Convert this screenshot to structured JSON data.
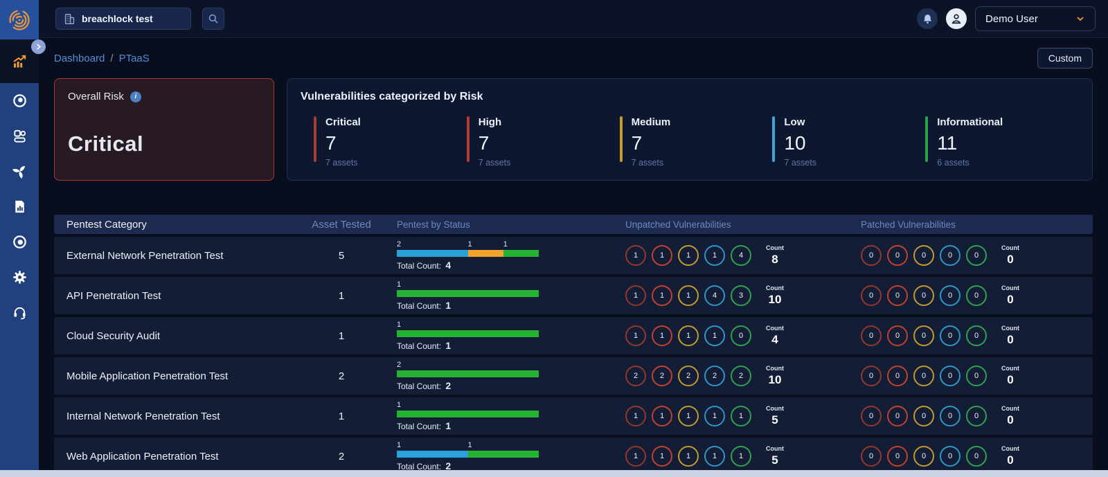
{
  "colors": {
    "accent_orange": "#f09b33",
    "severity_rings": [
      "#94372c",
      "#c2412f",
      "#c29b2f",
      "#2f96c8",
      "#30a24f"
    ],
    "risk_bars": {
      "critical": "#a93b32",
      "high": "#b73a2e",
      "medium": "#c79a2b",
      "low": "#3aa6d4",
      "informational": "#2aa24a"
    },
    "status_bar": {
      "blue": "#2aa4d8",
      "orange": "#f4a42c",
      "green": "#25b233"
    }
  },
  "topbar": {
    "search_value": "breachlock test",
    "user_label": "Demo User"
  },
  "sidebar": {
    "items": [
      {
        "icon": "trending-chart-icon",
        "active": true
      },
      {
        "icon": "monitor-eye-icon",
        "active": false
      },
      {
        "icon": "assets-icon",
        "active": false
      },
      {
        "icon": "scan-spiral-icon",
        "active": false
      },
      {
        "icon": "reports-icon",
        "active": false
      },
      {
        "icon": "target-icon",
        "active": false
      },
      {
        "icon": "settings-gear-icon",
        "active": false
      },
      {
        "icon": "support-headset-icon",
        "active": false
      }
    ]
  },
  "breadcrumb": {
    "section": "Dashboard",
    "separator": "/",
    "page": "PTaaS"
  },
  "actions": {
    "custom_label": "Custom"
  },
  "overall_risk": {
    "label": "Overall Risk",
    "value": "Critical"
  },
  "risk_summary": {
    "title": "Vulnerabilities categorized by Risk",
    "items": [
      {
        "label": "Critical",
        "value": "7",
        "assets": "7 assets",
        "color": "#a93b32"
      },
      {
        "label": "High",
        "value": "7",
        "assets": "7 assets",
        "color": "#b73a2e"
      },
      {
        "label": "Medium",
        "value": "7",
        "assets": "7 assets",
        "color": "#c79a2b"
      },
      {
        "label": "Low",
        "value": "10",
        "assets": "7 assets",
        "color": "#3aa6d4"
      },
      {
        "label": "Informational",
        "value": "11",
        "assets": "6 assets",
        "color": "#2aa24a"
      }
    ]
  },
  "table": {
    "columns": [
      "Pentest Category",
      "Asset Tested",
      "Pentest by Status",
      "Unpatched Vulnerabilities",
      "Patched Vulnerabilities"
    ],
    "total_count_label": "Total Count:",
    "count_label": "Count",
    "rows": [
      {
        "category": "External Network Penetration Test",
        "assets_tested": "5",
        "segments": [
          {
            "value": 2,
            "color": "#2aa4d8"
          },
          {
            "value": 1,
            "color": "#f4a42c"
          },
          {
            "value": 1,
            "color": "#25b233"
          }
        ],
        "total_count": "4",
        "unpatched": {
          "values": [
            "1",
            "1",
            "1",
            "1",
            "4"
          ],
          "count": "8"
        },
        "patched": {
          "values": [
            "0",
            "0",
            "0",
            "0",
            "0"
          ],
          "count": "0"
        }
      },
      {
        "category": "API Penetration Test",
        "assets_tested": "1",
        "segments": [
          {
            "value": 1,
            "color": "#25b233"
          }
        ],
        "total_count": "1",
        "unpatched": {
          "values": [
            "1",
            "1",
            "1",
            "4",
            "3"
          ],
          "count": "10"
        },
        "patched": {
          "values": [
            "0",
            "0",
            "0",
            "0",
            "0"
          ],
          "count": "0"
        }
      },
      {
        "category": "Cloud Security Audit",
        "assets_tested": "1",
        "segments": [
          {
            "value": 1,
            "color": "#25b233"
          }
        ],
        "total_count": "1",
        "unpatched": {
          "values": [
            "1",
            "1",
            "1",
            "1",
            "0"
          ],
          "count": "4"
        },
        "patched": {
          "values": [
            "0",
            "0",
            "0",
            "0",
            "0"
          ],
          "count": "0"
        }
      },
      {
        "category": "Mobile Application Penetration Test",
        "assets_tested": "2",
        "segments": [
          {
            "value": 2,
            "color": "#25b233"
          }
        ],
        "total_count": "2",
        "unpatched": {
          "values": [
            "2",
            "2",
            "2",
            "2",
            "2"
          ],
          "count": "10"
        },
        "patched": {
          "values": [
            "0",
            "0",
            "0",
            "0",
            "0"
          ],
          "count": "0"
        }
      },
      {
        "category": "Internal Network Penetration Test",
        "assets_tested": "1",
        "segments": [
          {
            "value": 1,
            "color": "#25b233"
          }
        ],
        "total_count": "1",
        "unpatched": {
          "values": [
            "1",
            "1",
            "1",
            "1",
            "1"
          ],
          "count": "5"
        },
        "patched": {
          "values": [
            "0",
            "0",
            "0",
            "0",
            "0"
          ],
          "count": "0"
        }
      },
      {
        "category": "Web Application Penetration Test",
        "assets_tested": "2",
        "segments": [
          {
            "value": 1,
            "color": "#2aa4d8"
          },
          {
            "value": 1,
            "color": "#25b233"
          }
        ],
        "total_count": "2",
        "unpatched": {
          "values": [
            "1",
            "1",
            "1",
            "1",
            "1"
          ],
          "count": "5"
        },
        "patched": {
          "values": [
            "0",
            "0",
            "0",
            "0",
            "0"
          ],
          "count": "0"
        }
      }
    ]
  }
}
